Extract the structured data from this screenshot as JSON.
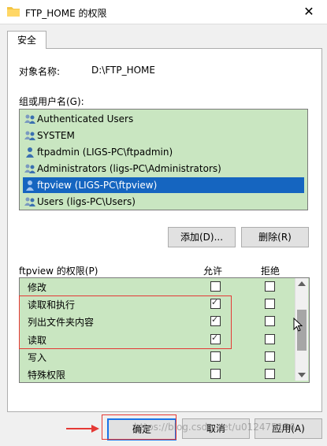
{
  "window": {
    "title": "FTP_HOME 的权限",
    "close": "✕"
  },
  "tabs": [
    {
      "label": "安全"
    }
  ],
  "object": {
    "label": "对象名称:",
    "value": "D:\\FTP_HOME"
  },
  "groups": {
    "label": "组或用户名(G):",
    "items": [
      {
        "name": "Authenticated Users",
        "icon": "group-icon",
        "selected": false
      },
      {
        "name": "SYSTEM",
        "icon": "group-icon",
        "selected": false
      },
      {
        "name": "ftpadmin (LIGS-PC\\ftpadmin)",
        "icon": "user-icon",
        "selected": false
      },
      {
        "name": "Administrators (ligs-PC\\Administrators)",
        "icon": "group-icon",
        "selected": false
      },
      {
        "name": "ftpview (LIGS-PC\\ftpview)",
        "icon": "user-icon",
        "selected": true
      },
      {
        "name": "Users (ligs-PC\\Users)",
        "icon": "group-icon",
        "selected": false
      }
    ],
    "add_label": "添加(D)...",
    "remove_label": "删除(R)"
  },
  "permissions": {
    "label": "ftpview 的权限(P)",
    "allow_header": "允许",
    "deny_header": "拒绝",
    "rows": [
      {
        "name": "修改",
        "allow": false,
        "deny": false
      },
      {
        "name": "读取和执行",
        "allow": true,
        "deny": false
      },
      {
        "name": "列出文件夹内容",
        "allow": true,
        "deny": false
      },
      {
        "name": "读取",
        "allow": true,
        "deny": false
      },
      {
        "name": "写入",
        "allow": false,
        "deny": false
      },
      {
        "name": "特殊权限",
        "allow": false,
        "deny": false
      }
    ]
  },
  "footer": {
    "ok_label": "确定",
    "cancel_label": "取消",
    "apply_label": "应用(A)"
  },
  "watermark": "https://blog.csdn.net/u012475136",
  "colors": {
    "list_bg": "#c9e6c1",
    "selection": "#1565c0",
    "highlight_box": "#e53935"
  }
}
